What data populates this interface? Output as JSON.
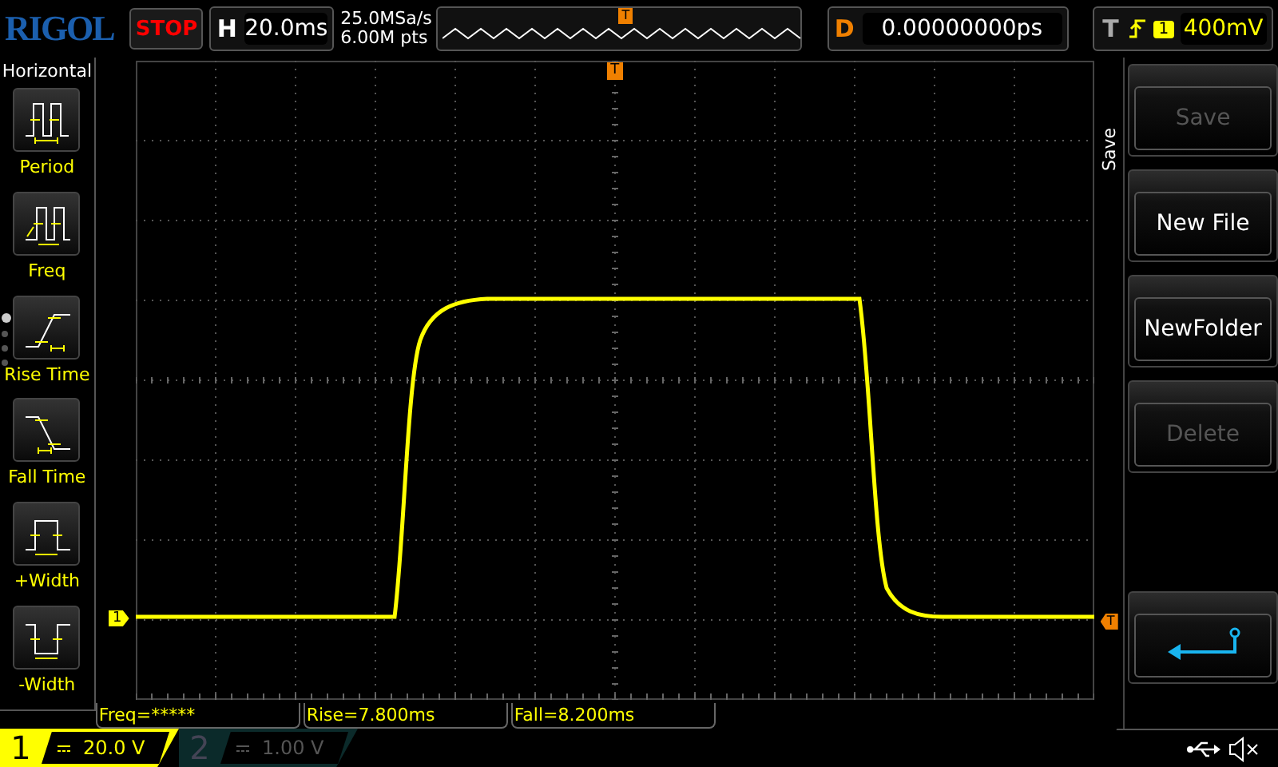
{
  "header": {
    "logo": "RIGOL",
    "run_state": "STOP",
    "timebase": {
      "label": "H",
      "value": "20.0ms"
    },
    "sample_rate": "25.0MSa/s",
    "memory_depth": "6.00M pts",
    "overview_marker": "T",
    "delay": {
      "label": "D",
      "value": "0.00000000ps"
    },
    "trigger": {
      "label": "T",
      "source": "1",
      "level": "400mV"
    }
  },
  "left_menu": {
    "title": "Horizontal",
    "items": [
      {
        "kind": "period",
        "label": "Period"
      },
      {
        "kind": "freq",
        "label": "Freq"
      },
      {
        "kind": "rise",
        "label": "Rise Time"
      },
      {
        "kind": "fall",
        "label": "Fall Time"
      },
      {
        "kind": "pwidth",
        "label": "+Width"
      },
      {
        "kind": "nwidth",
        "label": "-Width"
      }
    ],
    "pages": [
      {
        "selected": true
      },
      {
        "selected": false
      },
      {
        "selected": false
      },
      {
        "selected": false
      }
    ]
  },
  "screen": {
    "channel_marker": "1",
    "trigger_position_marker": "T",
    "trigger_level_marker": "T"
  },
  "measurements": [
    "Freq=*****",
    "Rise=7.800ms",
    "Fall=8.200ms"
  ],
  "right_menu": {
    "title": "Save",
    "slots": [
      {
        "kind": "button",
        "label": "Save",
        "disabled": true
      },
      {
        "kind": "button",
        "label": "New File",
        "disabled": false
      },
      {
        "kind": "button",
        "label": "NewFolder",
        "disabled": false
      },
      {
        "kind": "button",
        "label": "Delete",
        "disabled": true
      },
      {
        "kind": "empty"
      },
      {
        "kind": "back"
      }
    ]
  },
  "channels": [
    {
      "number": "1",
      "scale": "20.0 V",
      "active": true
    },
    {
      "number": "2",
      "scale": "1.00 V",
      "active": false
    }
  ]
}
